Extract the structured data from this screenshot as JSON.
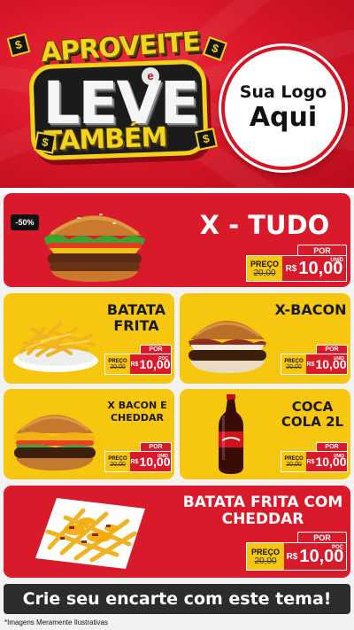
{
  "header": {
    "promo_line1": "APROVEITE",
    "promo_connector": "e",
    "promo_line2": "LEVE",
    "promo_line3": "TAMBÉM",
    "coin_symbol": "$",
    "logo_line1": "Sua Logo",
    "logo_line2": "Aqui"
  },
  "discount_badge": "-50%",
  "price_labels": {
    "por": "POR",
    "preco": "PREÇO",
    "currency": "R$"
  },
  "products": [
    {
      "name": "X - TUDO",
      "old_price": "20,00",
      "price": "10,00",
      "unit": "UNID",
      "style": "red"
    },
    {
      "name": "BATATA FRITA",
      "old_price": "20,00",
      "price": "10,00",
      "unit": "POÇ",
      "style": "yellow"
    },
    {
      "name": "X-BACON",
      "old_price": "20,00",
      "price": "10,00",
      "unit": "UNID",
      "style": "yellow"
    },
    {
      "name": "X BACON E CHEDDAR",
      "old_price": "20,00",
      "price": "10,00",
      "unit": "UNID",
      "style": "yellow"
    },
    {
      "name": "COCA COLA 2L",
      "old_price": "20,00",
      "price": "10,00",
      "unit": "UNID",
      "style": "yellow"
    },
    {
      "name": "BATATA FRITA COM CHEDDAR",
      "old_price": "20,00",
      "price": "10,00",
      "unit": "POÇ",
      "style": "red"
    }
  ],
  "footer": {
    "cta": "Crie seu encarte com este tema!",
    "disclaimer": "*Imagens Meramente Ilustrativas"
  },
  "colors": {
    "brand_red": "#d81a2a",
    "brand_yellow": "#f7c60f",
    "dark": "#2c2c2c"
  }
}
